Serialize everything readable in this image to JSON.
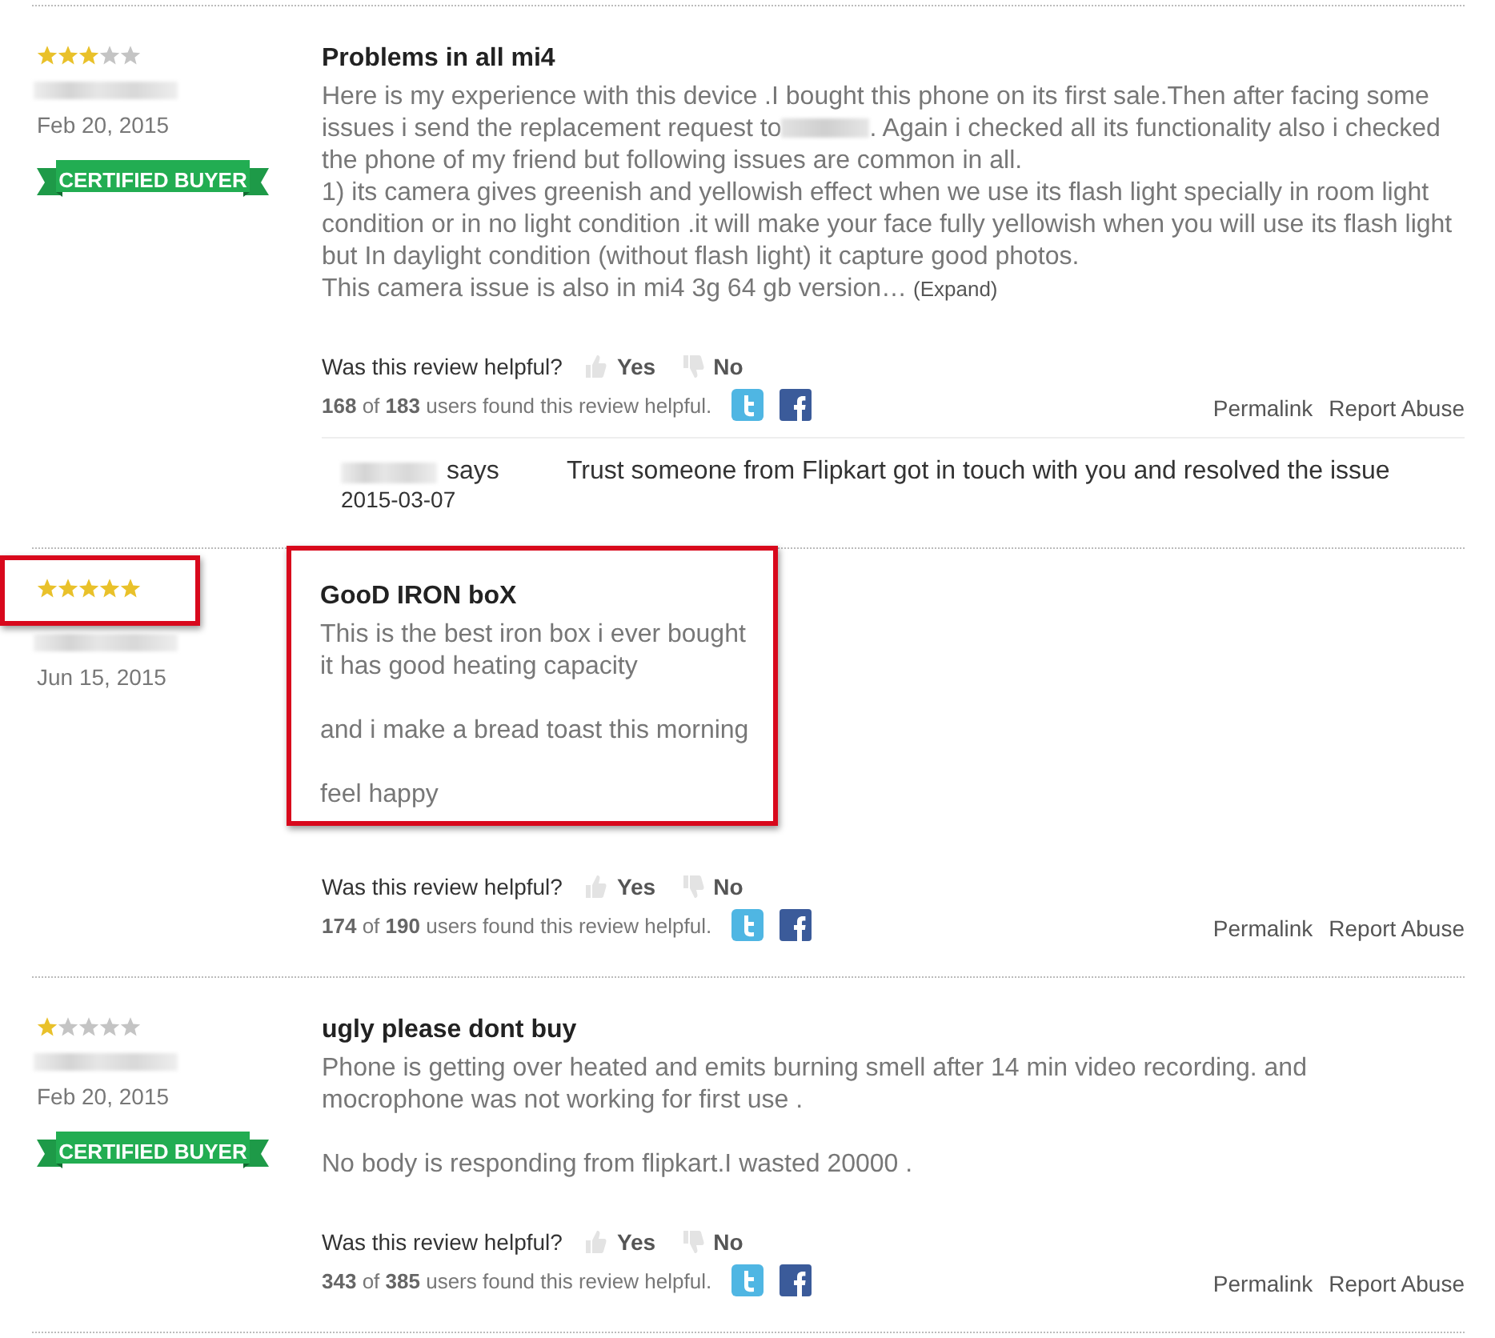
{
  "reviews": [
    {
      "stars": 3,
      "date": "Feb 20, 2015",
      "badge": "CERTIFIED BUYER",
      "title": "Problems in all mi4",
      "highlighted": false,
      "paragraphs": [
        [
          "Here is my experience with this device .I bought this phone on its first sale.Then after facing some issues i send the replacement request to",
          {
            "kind": "redaction"
          },
          ". Again i checked all its functionality also i checked the phone of my friend but following issues are common in all.",
          "1) its camera gives greenish and yellowish effect when we use its flash light specially in room light condition or in no light condition .it will make your face fully yellowish when you will use its flash light but In daylight condition (without flash light) it capture good photos.",
          "This camera issue is also in mi4 3g 64 gb version…"
        ]
      ],
      "expand": "(Expand)",
      "helpful_question": "Was this review helpful?",
      "yes": "Yes",
      "no": "No",
      "helpful_count": "**168** of **183** users found this review helpful.",
      "permalink": "Permalink",
      "report": "Report Abuse",
      "comments": [
        {
          "says": "says",
          "date": "2015-03-07",
          "text": "Trust someone from Flipkart got in touch with you and resolved the issue"
        }
      ]
    },
    {
      "stars": 5,
      "date": "Jun 15, 2015",
      "title": "GooD IRON boX",
      "highlighted": true,
      "paragraphs": [
        [
          "This is the best iron box i ever bought",
          "it has good heating capacity"
        ],
        [
          "and i make a bread toast this morning"
        ],
        [
          "feel happy"
        ]
      ],
      "helpful_question": "Was this review helpful?",
      "yes": "Yes",
      "no": "No",
      "helpful_count": "**174** of **190** users found this review helpful.",
      "permalink": "Permalink",
      "report": "Report Abuse"
    },
    {
      "stars": 1,
      "date": "Feb 20, 2015",
      "badge": "CERTIFIED BUYER",
      "title": "ugly please dont buy",
      "highlighted": false,
      "paragraphs": [
        [
          "Phone is getting over heated and emits burning smell after 14 min video recording. and",
          "mocrophone was not working for first use ."
        ],
        [
          "No body is responding from flipkart.I wasted 20000 ."
        ]
      ],
      "helpful_question": "Was this review helpful?",
      "yes": "Yes",
      "no": "No",
      "helpful_count": "**343** of **385** users found this review helpful.",
      "permalink": "Permalink",
      "report": "Report Abuse"
    }
  ]
}
